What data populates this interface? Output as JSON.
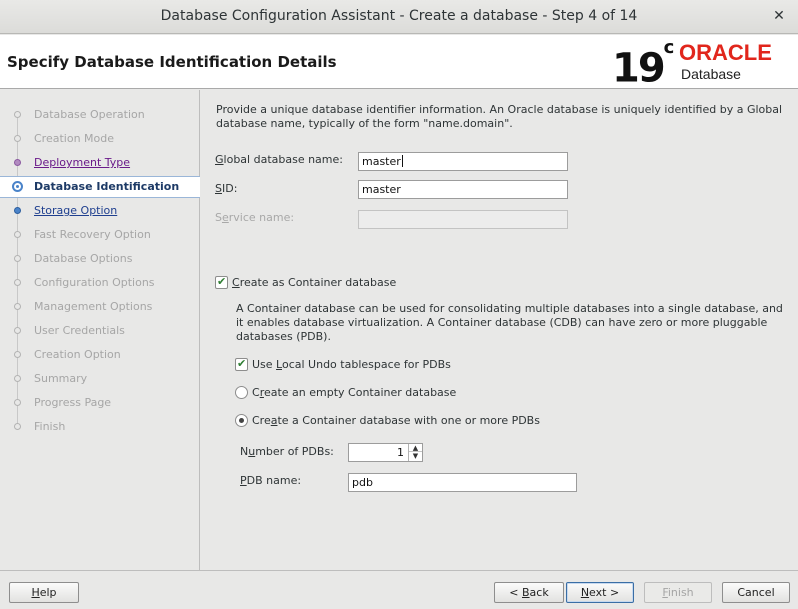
{
  "window": {
    "title": "Database Configuration Assistant - Create a database - Step 4 of 14",
    "close_glyph": "✕"
  },
  "header": {
    "page_title": "Specify Database Identification Details",
    "logo_version": "19",
    "logo_version_sup": "c",
    "logo_brand": "ORACLE",
    "logo_sub": "Database",
    "brand_color": "#e1261c"
  },
  "sidebar": {
    "steps": [
      {
        "label": "Database Operation",
        "state": "disabled"
      },
      {
        "label": "Creation Mode",
        "state": "disabled"
      },
      {
        "label": "Deployment Type",
        "state": "done"
      },
      {
        "label": "Database Identification",
        "state": "current"
      },
      {
        "label": "Storage Option",
        "state": "next"
      },
      {
        "label": "Fast Recovery Option",
        "state": "disabled"
      },
      {
        "label": "Database Options",
        "state": "disabled"
      },
      {
        "label": "Configuration Options",
        "state": "disabled"
      },
      {
        "label": "Management Options",
        "state": "disabled"
      },
      {
        "label": "User Credentials",
        "state": "disabled"
      },
      {
        "label": "Creation Option",
        "state": "disabled"
      },
      {
        "label": "Summary",
        "state": "disabled"
      },
      {
        "label": "Progress Page",
        "state": "disabled"
      },
      {
        "label": "Finish",
        "state": "disabled"
      }
    ]
  },
  "main": {
    "intro": "Provide a unique database identifier information. An Oracle database is uniquely identified by a Global database name, typically of the form \"name.domain\".",
    "global_db_name": {
      "mnemonic": "G",
      "label_rest": "lobal database name:",
      "value": "master"
    },
    "sid": {
      "mnemonic": "S",
      "label_rest": "ID:",
      "value": "master"
    },
    "service_name": {
      "label_pre": "S",
      "mnemonic": "e",
      "label_rest": "rvice name:",
      "value": ""
    },
    "container_db": {
      "mnemonic": "C",
      "label_rest": "reate as Container database",
      "checked": true
    },
    "container_desc": "A Container database can be used for consolidating multiple databases into a single database, and it enables database virtualization. A Container database (CDB) can have zero or more pluggable databases (PDB).",
    "local_undo": {
      "label_pre": "Use ",
      "mnemonic": "L",
      "label_rest": "ocal Undo tablespace for PDBs",
      "checked": true
    },
    "empty_cdb": {
      "label_pre": "C",
      "mnemonic": "r",
      "label_rest": "eate an empty Container database",
      "selected": false
    },
    "cdb_with_pdbs": {
      "label_pre": "Cre",
      "mnemonic": "a",
      "label_rest": "te a Container database with one or more PDBs",
      "selected": true
    },
    "num_pdbs": {
      "label_pre": "N",
      "mnemonic": "u",
      "label_rest": "mber of PDBs:",
      "value": "1",
      "up_glyph": "▲",
      "down_glyph": "▼"
    },
    "pdb_name": {
      "mnemonic": "P",
      "label_rest": "DB name:",
      "value": "pdb"
    }
  },
  "footer": {
    "help": {
      "mnemonic": "H",
      "label_rest": "elp"
    },
    "back": {
      "label_pre": "< ",
      "mnemonic": "B",
      "label_rest": "ack"
    },
    "next": {
      "mnemonic": "N",
      "label_rest": "ext >"
    },
    "finish": {
      "mnemonic": "F",
      "label_rest": "inish"
    },
    "cancel": {
      "label": "Cancel"
    }
  }
}
